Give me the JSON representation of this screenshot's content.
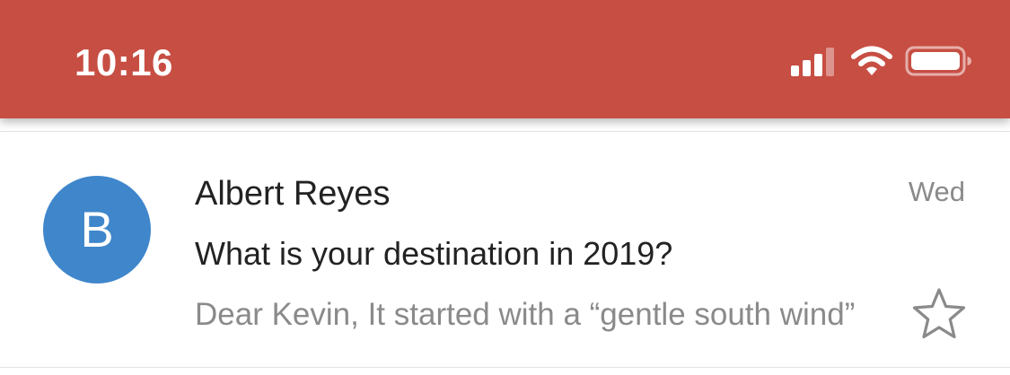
{
  "status_bar": {
    "time": "10:16",
    "background_color": "#c74e43",
    "icons": [
      "signal-icon",
      "wifi-icon",
      "battery-icon"
    ]
  },
  "email": {
    "avatar_letter": "B",
    "avatar_color": "#3f86cb",
    "sender": "Albert Reyes",
    "date": "Wed",
    "subject": "What is your destination in 2019?",
    "snippet": "Dear Kevin, It started with a “gentle south wind”",
    "starred": false,
    "star_icon": "star-outline-icon"
  }
}
